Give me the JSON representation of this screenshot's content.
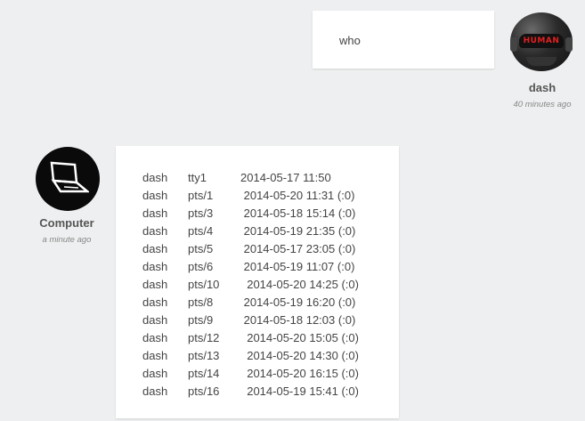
{
  "user_message": {
    "text": "who",
    "author": "dash",
    "time": "40 minutes ago",
    "avatar_label": "HUMAN",
    "avatar_icon": "human-helmet-icon"
  },
  "computer_message": {
    "author": "Computer",
    "time": "a minute ago",
    "avatar_icon": "laptop-icon",
    "rows": [
      {
        "user": "dash",
        "tty": "tty1",
        "when": "2014-05-17 11:50"
      },
      {
        "user": "dash",
        "tty": "pts/1",
        "when": " 2014-05-20 11:31 (:0)"
      },
      {
        "user": "dash",
        "tty": "pts/3",
        "when": " 2014-05-18 15:14 (:0)"
      },
      {
        "user": "dash",
        "tty": "pts/4",
        "when": " 2014-05-19 21:35 (:0)"
      },
      {
        "user": "dash",
        "tty": "pts/5",
        "when": " 2014-05-17 23:05 (:0)"
      },
      {
        "user": "dash",
        "tty": "pts/6",
        "when": " 2014-05-19 11:07 (:0)"
      },
      {
        "user": "dash",
        "tty": "pts/10",
        "when": "  2014-05-20 14:25 (:0)"
      },
      {
        "user": "dash",
        "tty": "pts/8",
        "when": " 2014-05-19 16:20 (:0)"
      },
      {
        "user": "dash",
        "tty": "pts/9",
        "when": " 2014-05-18 12:03 (:0)"
      },
      {
        "user": "dash",
        "tty": "pts/12",
        "when": "  2014-05-20 15:05 (:0)"
      },
      {
        "user": "dash",
        "tty": "pts/13",
        "when": "  2014-05-20 14:30 (:0)"
      },
      {
        "user": "dash",
        "tty": "pts/14",
        "when": "  2014-05-20 16:15 (:0)"
      },
      {
        "user": "dash",
        "tty": "pts/16",
        "when": "  2014-05-19 15:41 (:0)"
      }
    ]
  }
}
